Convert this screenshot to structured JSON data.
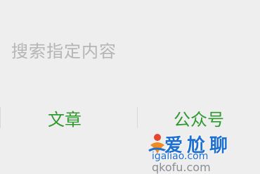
{
  "search": {
    "placeholder": "搜索指定内容"
  },
  "categories": [
    {
      "label": "文章"
    },
    {
      "label": "公众号"
    }
  ],
  "watermark": {
    "text": "爱尬聊",
    "domain_top": "igaliao.com",
    "domain_bottom": "qkofu.com"
  },
  "colors": {
    "background": "#eeeeef",
    "accent_green": "#2e9a2e",
    "placeholder_gray": "#b5b5b5",
    "watermark_blue": "#1d6fd0"
  }
}
